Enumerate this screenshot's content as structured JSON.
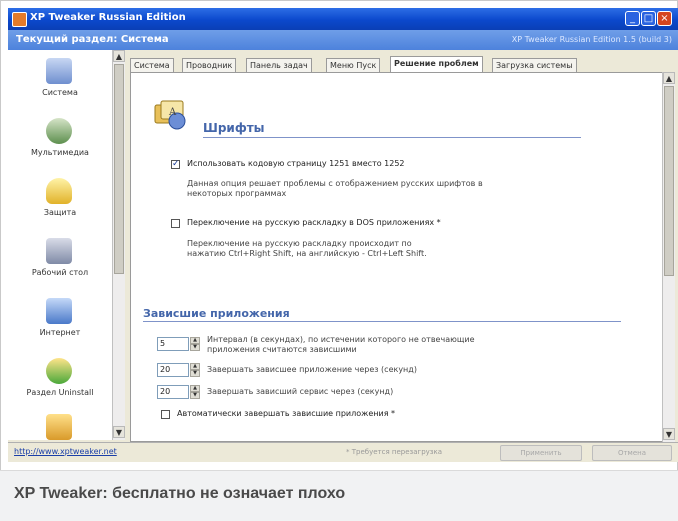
{
  "window": {
    "title": "XP Tweaker Russian Edition",
    "title_buttons": {
      "minimize": "_",
      "maximize": "□",
      "close": "×"
    }
  },
  "infobar": {
    "breadcrumb": "Текущий раздел:  Система",
    "edition": "XP Tweaker Russian Edition 1.5 (build 3)"
  },
  "sidebar": {
    "items": [
      {
        "label": "Система",
        "icon": "system-icon"
      },
      {
        "label": "Мультимедиа",
        "icon": "multimedia-icon"
      },
      {
        "label": "Защита",
        "icon": "security-icon"
      },
      {
        "label": "Рабочий стол",
        "icon": "desktop-icon"
      },
      {
        "label": "Интернет",
        "icon": "network-icon"
      },
      {
        "label": "Раздел Uninstall",
        "icon": "uninstall-icon"
      },
      {
        "label": "",
        "icon": "folder-icon"
      }
    ]
  },
  "tabs": [
    {
      "label": "Система"
    },
    {
      "label": "Проводник"
    },
    {
      "label": "Панель задач"
    },
    {
      "label": "Меню Пуск"
    },
    {
      "label": "Решение проблем",
      "active": true
    },
    {
      "label": "Загрузка системы"
    }
  ],
  "fonts_section": {
    "title": "Шрифты",
    "option1": {
      "checked": true,
      "label": "Использовать кодовую страницу 1251 вместо 1252",
      "desc1": "Данная опция решает проблемы с отображением русских шрифтов в",
      "desc2": "некоторых программах"
    },
    "option2": {
      "checked": false,
      "label": "Переключение на русскую раскладку в DOS приложениях *",
      "desc1": "Переключение на русскую раскладку происходит по",
      "desc2": "нажатию Ctrl+Right Shift, на английскую - Ctrl+Left Shift."
    }
  },
  "hang_section": {
    "title": "Зависшие приложения",
    "rows": [
      {
        "value": "5",
        "text1": "Интервал (в секундах), по истечении которого не отвечающие",
        "text2": "приложения считаются зависшими"
      },
      {
        "value": "20",
        "text1": "Завершать зависшее приложение через (секунд)",
        "text2": ""
      },
      {
        "value": "20",
        "text1": "Завершать зависший сервис через (секунд)",
        "text2": ""
      }
    ],
    "auto_close": {
      "checked": false,
      "label": "Автоматически завершать зависшие приложения *"
    }
  },
  "statusbar": {
    "link": "http://www.xptweaker.net",
    "note": "* Требуется перезагрузка",
    "apply_label": "Применить",
    "cancel_label": "Отмена"
  },
  "caption": {
    "text": "XP Tweaker: бесплатно не означает плохо"
  },
  "colors": {
    "titlebar": "#0b48cc",
    "section_title": "#4466aa",
    "link": "#1b3fa8"
  }
}
